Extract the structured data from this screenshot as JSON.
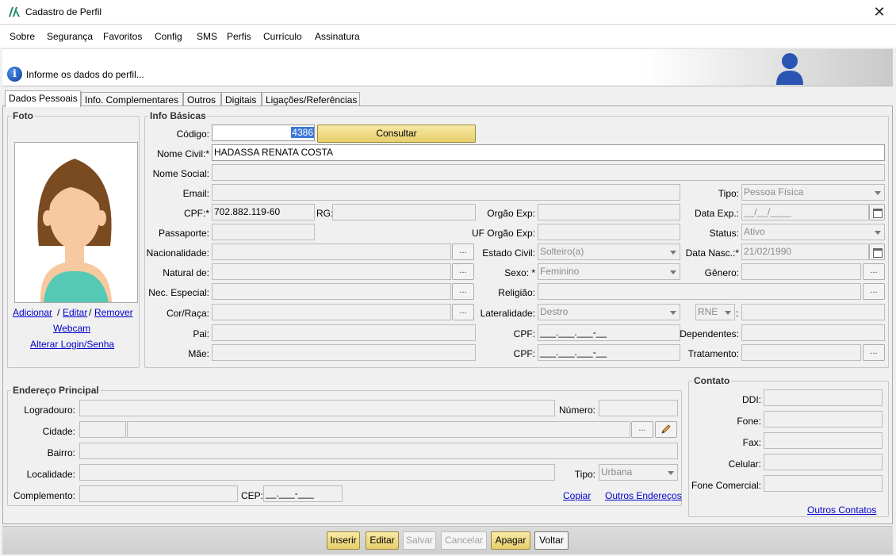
{
  "window": {
    "title": "Cadastro de Perfil",
    "close": "✕"
  },
  "menu": [
    {
      "label": "Sobre"
    },
    {
      "label": "Segurança"
    },
    {
      "label": "Favoritos"
    },
    {
      "label": "Config"
    },
    {
      "label": "SMS"
    },
    {
      "label": "Perfis"
    },
    {
      "label": "Currículo"
    },
    {
      "label": "Assinatura"
    }
  ],
  "header": {
    "message": "Informe os dados do perfil..."
  },
  "tabs": [
    {
      "label": "Dados Pessoais"
    },
    {
      "label": "Info. Complementares"
    },
    {
      "label": "Outros"
    },
    {
      "label": "Digitais"
    },
    {
      "label": "Ligações/Referências"
    }
  ],
  "foto": {
    "legend": "Foto",
    "adicionar": "Adicionar",
    "sep1": "/",
    "editar": "Editar",
    "sep2": "/",
    "remover": "Remover",
    "webcam": "Webcam",
    "alterar_login": "Alterar Login/Senha"
  },
  "info": {
    "legend": "Info Básicas",
    "codigo_label": "Código:",
    "codigo_value": "4386",
    "consultar": "Consultar",
    "nome_civil_label": "Nome Civil:*",
    "nome_civil_value": "HADASSA RENATA COSTA",
    "nome_social_label": "Nome Social:",
    "email_label": "Email:",
    "tipo_label": "Tipo:",
    "tipo_value": "Pessoa Física",
    "cpf_label": "CPF:*",
    "cpf_value": "702.882.119-60",
    "rg_label": "RG:",
    "orgao_exp_label": "Orgão Exp:",
    "data_exp_label": "Data Exp.:",
    "data_exp_value": "__/__/____",
    "passaporte_label": "Passaporte:",
    "uf_orgao_label": "UF Orgão Exp:",
    "status_label": "Status:",
    "status_value": "Ativo",
    "nacionalidade_label": "Nacionalidade:",
    "estado_civil_label": "Estado Civil:",
    "estado_civil_value": "Solteiro(a)",
    "data_nasc_label": "Data Nasc.:*",
    "data_nasc_value": "21/02/1990",
    "natural_label": "Natural de:",
    "sexo_label": "Sexo: *",
    "sexo_value": "Feminino",
    "genero_label": "Gênero:",
    "nec_especial_label": "Nec. Especial:",
    "religiao_label": "Religião:",
    "cor_raca_label": "Cor/Raça:",
    "lateralidade_label": "Lateralidade:",
    "lateralidade_value": "Destro",
    "rne_value": "RNE",
    "rne_colon": ":",
    "pai_label": "Pai:",
    "cpf_pai_label": "CPF:",
    "cpf_pai_value": "___.___.___-__",
    "dependentes_label": "Dependentes:",
    "mae_label": "Mãe:",
    "cpf_mae_label": "CPF:",
    "cpf_mae_value": "___.___.___-__",
    "tratamento_label": "Tratamento:",
    "ellipsis": "..."
  },
  "endereco": {
    "legend": "Endereço Principal",
    "logradouro_label": "Logradouro:",
    "numero_label": "Número:",
    "cidade_label": "Cidade:",
    "bairro_label": "Bairro:",
    "localidade_label": "Localidade:",
    "tipo_label": "Tipo:",
    "tipo_value": "Urbana",
    "complemento_label": "Complemento:",
    "cep_label": "CEP:",
    "cep_value": "__.___-___",
    "copiar": "Copiar",
    "outros_enderecos": "Outros Endereços"
  },
  "contato": {
    "legend": "Contato",
    "ddi_label": "DDI:",
    "fone_label": "Fone:",
    "fax_label": "Fax:",
    "celular_label": "Celular:",
    "fone_comercial_label": "Fone Comercial:",
    "outros_contatos": "Outros Contatos"
  },
  "buttons": {
    "inserir": "Inserir",
    "editar": "Editar",
    "salvar": "Salvar",
    "cancelar": "Cancelar",
    "apagar": "Apagar",
    "voltar": "Voltar"
  },
  "colors": {
    "accent_gold": "#e8cf6c",
    "link": "#0000cc",
    "selection": "#3a78d8"
  }
}
